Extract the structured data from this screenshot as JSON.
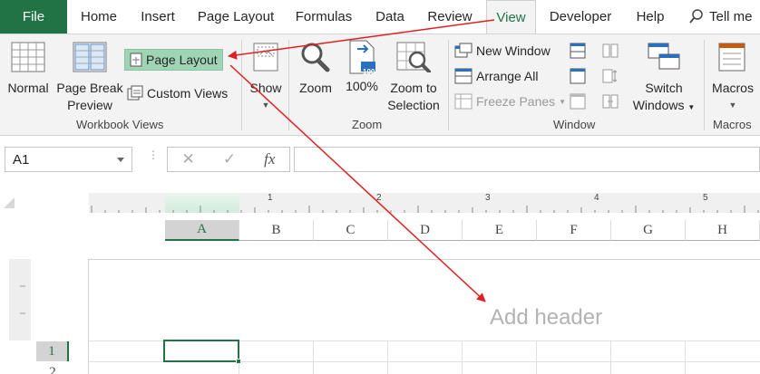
{
  "tabs": {
    "file": "File",
    "home": "Home",
    "insert": "Insert",
    "page_layout": "Page Layout",
    "formulas": "Formulas",
    "data": "Data",
    "review": "Review",
    "view": "View",
    "developer": "Developer",
    "help": "Help",
    "tell_me": "Tell me"
  },
  "ribbon": {
    "workbook_views": {
      "normal": "Normal",
      "page_break_1": "Page Break",
      "page_break_2": "Preview",
      "page_layout": "Page Layout",
      "custom_views": "Custom Views",
      "group_label": "Workbook Views"
    },
    "show": {
      "label": "Show"
    },
    "zoom": {
      "zoom": "Zoom",
      "zoom_100": "100%",
      "zoom_100_icon_text": "100",
      "zoom_to_1": "Zoom to",
      "zoom_to_2": "Selection",
      "group_label": "Zoom"
    },
    "window": {
      "new_window": "New Window",
      "arrange_all": "Arrange All",
      "freeze_panes": "Freeze Panes",
      "switch_1": "Switch",
      "switch_2": "Windows",
      "group_label": "Window"
    },
    "macros": {
      "label": "Macros",
      "group_label": "Macros"
    }
  },
  "formula_bar": {
    "name_box": "A1",
    "cancel_glyph": "✕",
    "enter_glyph": "✓",
    "fx_glyph": "fx",
    "formula_value": ""
  },
  "sheet": {
    "ruler_numbers": [
      "1",
      "2",
      "3",
      "4",
      "5"
    ],
    "columns": [
      "A",
      "B",
      "C",
      "D",
      "E",
      "F",
      "G",
      "H"
    ],
    "selected_column": "A",
    "rows": [
      "1",
      "2"
    ],
    "selected_row": "1",
    "add_header": "Add header"
  },
  "annotations": {
    "arrow_color": "#e02020"
  },
  "colors": {
    "excel_green": "#217346",
    "highlight": "#9fd5b5"
  }
}
